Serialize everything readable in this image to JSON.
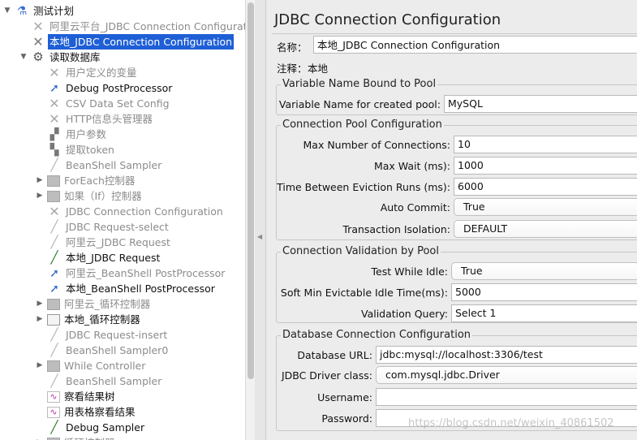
{
  "tree": [
    {
      "label": "测试计划",
      "icon": "flask-icon",
      "glyph": "⚗",
      "cls": "flask",
      "toggle": "▼",
      "indent": 0,
      "disabled": false,
      "selected": false
    },
    {
      "label": "阿里云平台_JDBC Connection Configuration",
      "icon": "config-tool-icon",
      "glyph": "✕",
      "cls": "tool",
      "toggle": "",
      "indent": 1,
      "disabled": true,
      "selected": false
    },
    {
      "label": "本地_JDBC Connection Configuration",
      "icon": "config-tool-icon",
      "glyph": "✕",
      "cls": "tool",
      "toggle": "",
      "indent": 1,
      "disabled": false,
      "selected": true
    },
    {
      "label": "读取数据库",
      "icon": "thread-group-gear-icon",
      "glyph": "⚙",
      "cls": "gear",
      "toggle": "▼",
      "indent": 1,
      "disabled": false,
      "selected": false
    },
    {
      "label": "用户定义的变量",
      "icon": "config-tool-icon",
      "glyph": "✕",
      "cls": "tool",
      "toggle": "",
      "indent": 2,
      "disabled": true,
      "selected": false
    },
    {
      "label": "Debug PostProcessor",
      "icon": "postprocessor-arrow-icon",
      "glyph": "➚",
      "cls": "arrow",
      "toggle": "",
      "indent": 2,
      "disabled": false,
      "selected": false
    },
    {
      "label": "CSV Data Set Config",
      "icon": "config-tool-icon",
      "glyph": "✕",
      "cls": "tool",
      "toggle": "",
      "indent": 2,
      "disabled": true,
      "selected": false
    },
    {
      "label": "HTTP信息头管理器",
      "icon": "config-tool-icon",
      "glyph": "✕",
      "cls": "tool",
      "toggle": "",
      "indent": 2,
      "disabled": true,
      "selected": false
    },
    {
      "label": "用户参数",
      "icon": "preprocessor-icon",
      "glyph": "▞",
      "cls": "tmpl",
      "toggle": "",
      "indent": 2,
      "disabled": true,
      "selected": false
    },
    {
      "label": "提取token",
      "icon": "extractor-icon",
      "glyph": "▚",
      "cls": "tmpl",
      "toggle": "",
      "indent": 2,
      "disabled": true,
      "selected": false
    },
    {
      "label": "BeanShell Sampler",
      "icon": "sampler-wand-icon",
      "glyph": "╱",
      "cls": "wand",
      "toggle": "",
      "indent": 2,
      "disabled": true,
      "selected": false
    },
    {
      "label": "ForEach控制器",
      "icon": "controller-box-icon",
      "glyph": "",
      "cls": "box",
      "toggle": "▶",
      "indent": 2,
      "disabled": true,
      "selected": false
    },
    {
      "label": "如果（If）控制器",
      "icon": "controller-box-icon",
      "glyph": "",
      "cls": "box",
      "toggle": "▶",
      "indent": 2,
      "disabled": true,
      "selected": false
    },
    {
      "label": "JDBC Connection Configuration",
      "icon": "config-tool-icon",
      "glyph": "✕",
      "cls": "tool",
      "toggle": "",
      "indent": 2,
      "disabled": true,
      "selected": false
    },
    {
      "label": "JDBC Request-select",
      "icon": "sampler-wand-icon",
      "glyph": "╱",
      "cls": "wand",
      "toggle": "",
      "indent": 2,
      "disabled": true,
      "selected": false
    },
    {
      "label": "阿里云_JDBC Request",
      "icon": "sampler-wand-icon",
      "glyph": "╱",
      "cls": "wand",
      "toggle": "",
      "indent": 2,
      "disabled": true,
      "selected": false
    },
    {
      "label": "本地_JDBC Request",
      "icon": "sampler-wand-icon",
      "glyph": "╱",
      "cls": "wand green",
      "toggle": "",
      "indent": 2,
      "disabled": false,
      "selected": false
    },
    {
      "label": "阿里云_BeanShell PostProcessor",
      "icon": "postprocessor-arrow-icon",
      "glyph": "➚",
      "cls": "arrow",
      "toggle": "",
      "indent": 2,
      "disabled": true,
      "selected": false
    },
    {
      "label": "本地_BeanShell PostProcessor",
      "icon": "postprocessor-arrow-icon",
      "glyph": "➚",
      "cls": "arrow",
      "toggle": "",
      "indent": 2,
      "disabled": false,
      "selected": false
    },
    {
      "label": "阿里云_循环控制器",
      "icon": "controller-box-icon",
      "glyph": "",
      "cls": "box",
      "toggle": "▶",
      "indent": 2,
      "disabled": true,
      "selected": false
    },
    {
      "label": "本地_循环控制器",
      "icon": "loop-controller-icon",
      "glyph": "",
      "cls": "box white",
      "toggle": "▶",
      "indent": 2,
      "disabled": false,
      "selected": false
    },
    {
      "label": "JDBC Request-insert",
      "icon": "sampler-wand-icon",
      "glyph": "╱",
      "cls": "wand",
      "toggle": "",
      "indent": 2,
      "disabled": true,
      "selected": false
    },
    {
      "label": "BeanShell Sampler0",
      "icon": "sampler-wand-icon",
      "glyph": "╱",
      "cls": "wand",
      "toggle": "",
      "indent": 2,
      "disabled": true,
      "selected": false
    },
    {
      "label": "While Controller",
      "icon": "controller-box-icon",
      "glyph": "",
      "cls": "box",
      "toggle": "▶",
      "indent": 2,
      "disabled": true,
      "selected": false
    },
    {
      "label": "BeanShell Sampler",
      "icon": "sampler-wand-icon",
      "glyph": "╱",
      "cls": "wand",
      "toggle": "",
      "indent": 2,
      "disabled": true,
      "selected": false
    },
    {
      "label": "察看结果树",
      "icon": "listener-chart-icon",
      "glyph": "∿",
      "cls": "chart",
      "toggle": "",
      "indent": 2,
      "disabled": false,
      "selected": false
    },
    {
      "label": "用表格察看结果",
      "icon": "listener-chart-icon",
      "glyph": "∿",
      "cls": "chart",
      "toggle": "",
      "indent": 2,
      "disabled": false,
      "selected": false
    },
    {
      "label": "Debug Sampler",
      "icon": "sampler-wand-icon",
      "glyph": "╱",
      "cls": "wand green",
      "toggle": "",
      "indent": 2,
      "disabled": false,
      "selected": false
    },
    {
      "label": "循环控制器",
      "icon": "controller-box-icon",
      "glyph": "",
      "cls": "box",
      "toggle": "▶",
      "indent": 2,
      "disabled": true,
      "selected": false
    }
  ],
  "panel": {
    "title": "JDBC Connection Configuration",
    "name_label": "名称：",
    "name_value": "本地_JDBC Connection Configuration",
    "comment_label": "注释：",
    "comment_value": "本地"
  },
  "groups": {
    "pool_var": {
      "title": "Variable Name Bound to Pool",
      "var_label": "Variable Name for created pool:",
      "var_value": "MySQL"
    },
    "pool_cfg": {
      "title": "Connection Pool Configuration",
      "max_conn_label": "Max Number of Connections:",
      "max_conn_value": "10",
      "max_wait_label": "Max Wait (ms):",
      "max_wait_value": "1000",
      "eviction_label": "Time Between Eviction Runs (ms):",
      "eviction_value": "6000",
      "auto_commit_label": "Auto Commit:",
      "auto_commit_value": "True",
      "isolation_label": "Transaction Isolation:",
      "isolation_value": "DEFAULT"
    },
    "validation": {
      "title": "Connection Validation by Pool",
      "test_idle_label": "Test While Idle:",
      "test_idle_value": "True",
      "soft_min_label": "Soft Min Evictable Idle Time(ms):",
      "soft_min_value": "5000",
      "query_label": "Validation Query:",
      "query_value": "Select 1"
    },
    "db": {
      "title": "Database Connection Configuration",
      "url_label": "Database URL:",
      "url_value": "jdbc:mysql://localhost:3306/test",
      "driver_label": "JDBC Driver class:",
      "driver_value": "com.mysql.jdbc.Driver",
      "user_label": "Username:",
      "user_value": "",
      "pass_label": "Password:",
      "pass_value": ""
    }
  },
  "watermark": "https://blog.csdn.net/weixin_40861502"
}
